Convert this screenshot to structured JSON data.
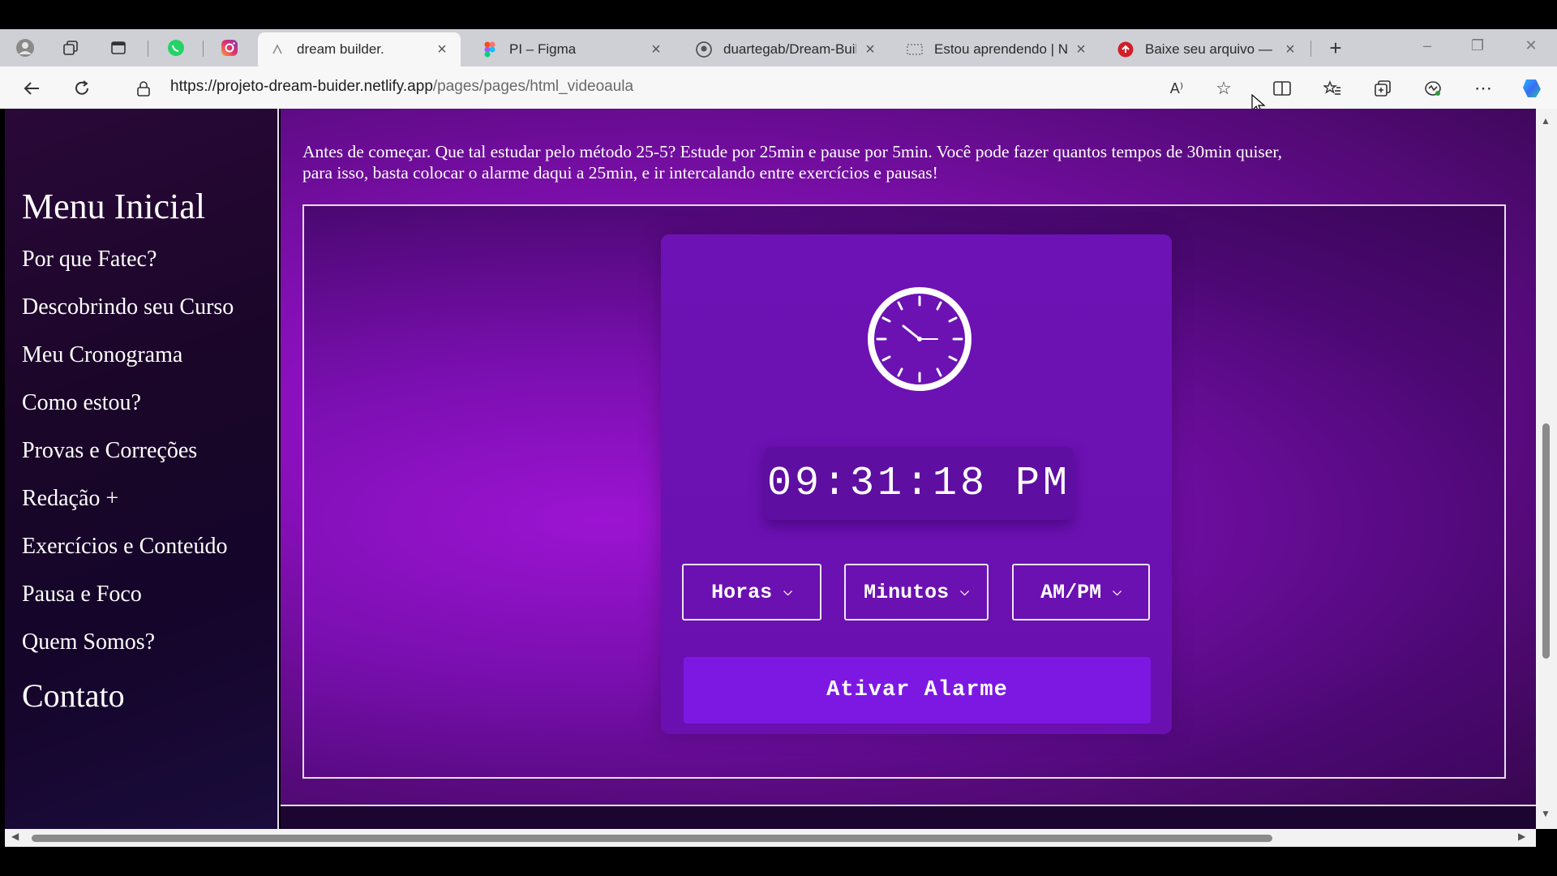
{
  "browser": {
    "tabs": [
      {
        "title": "dream builder.",
        "favicon": "netlify-icon",
        "active": true
      },
      {
        "title": "PI – Figma",
        "favicon": "figma-icon",
        "active": false
      },
      {
        "title": "duartegab/Dream-Buil",
        "favicon": "github-icon",
        "active": false
      },
      {
        "title": "Estou aprendendo | N",
        "favicon": "site-icon",
        "active": false
      },
      {
        "title": "Baixe seu arquivo — C",
        "favicon": "download-icon",
        "active": false
      }
    ],
    "url_host": "https://projeto-dream-buider.netlify.app",
    "url_path": "/pages/pages/html_videoaula",
    "read_aloud_label": "A⁾"
  },
  "sidebar": {
    "title": "Menu Inicial",
    "items": [
      "Por que Fatec?",
      "Descobrindo seu Curso",
      "Meu Cronograma",
      "Como estou?",
      "Provas e Correções",
      "Redação +",
      "Exercícios e Conteúdo",
      "Pausa e Foco",
      "Quem Somos?"
    ],
    "contact": "Contato"
  },
  "main": {
    "intro_line1": "Antes de começar. Que tal estudar pelo método 25-5? Estude por 25min e pause por 5min. Você pode fazer quantos tempos de 30min quiser,",
    "intro_line2": "para isso, basta colocar o alarme daqui a 25min, e ir intercalando entre exercícios e pausas!",
    "alarm": {
      "time": "09:31:18 PM",
      "hours_label": "Horas",
      "minutes_label": "Minutos",
      "ampm_label": "AM/PM",
      "button_label": "Ativar Alarme"
    }
  },
  "colors": {
    "accent": "#7d18e3",
    "card": "#6d12b4",
    "sidebar": "#1a0628"
  }
}
